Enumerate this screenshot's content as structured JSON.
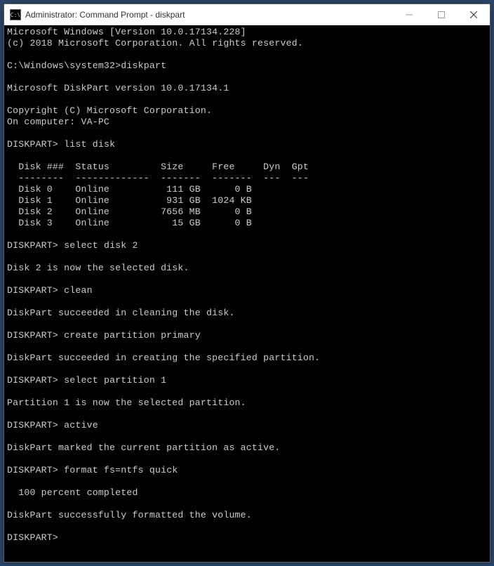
{
  "window": {
    "title": "Administrator: Command Prompt - diskpart",
    "icon_glyph": "C:\\"
  },
  "terminal": {
    "header_line1": "Microsoft Windows [Version 10.0.17134.228]",
    "header_line2": "(c) 2018 Microsoft Corporation. All rights reserved.",
    "initial_prompt": "C:\\Windows\\system32>",
    "initial_cmd": "diskpart",
    "diskpart_version": "Microsoft DiskPart version 10.0.17134.1",
    "copyright": "Copyright (C) Microsoft Corporation.",
    "computer_line": "On computer: VA-PC",
    "prompt": "DISKPART>",
    "cmds": {
      "list_disk": "list disk",
      "select_disk": "select disk 2",
      "clean": "clean",
      "create_partition": "create partition primary",
      "select_partition": "select partition 1",
      "active": "active",
      "format": "format fs=ntfs quick"
    },
    "table": {
      "header": "  Disk ###  Status         Size     Free     Dyn  Gpt",
      "divider": "  --------  -------------  -------  -------  ---  ---",
      "rows": [
        "  Disk 0    Online          111 GB      0 B",
        "  Disk 1    Online          931 GB  1024 KB",
        "  Disk 2    Online         7656 MB      0 B",
        "  Disk 3    Online           15 GB      0 B"
      ]
    },
    "msgs": {
      "disk_selected": "Disk 2 is now the selected disk.",
      "clean_ok": "DiskPart succeeded in cleaning the disk.",
      "partition_created": "DiskPart succeeded in creating the specified partition.",
      "partition_selected": "Partition 1 is now the selected partition.",
      "active_ok": "DiskPart marked the current partition as active.",
      "format_progress": "  100 percent completed",
      "format_ok": "DiskPart successfully formatted the volume."
    }
  }
}
